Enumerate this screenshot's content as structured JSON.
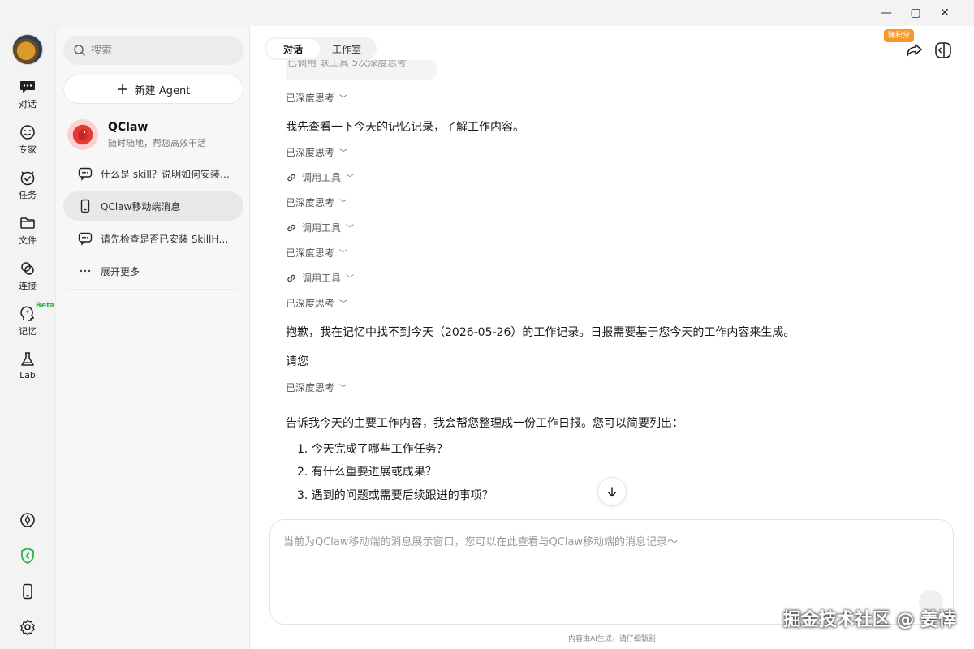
{
  "window": {
    "minimize": "—",
    "maximize": "▢",
    "close": "✕"
  },
  "rail": {
    "items": [
      {
        "label": "对话",
        "icon": "chat-icon"
      },
      {
        "label": "专家",
        "icon": "expert-icon"
      },
      {
        "label": "任务",
        "icon": "task-icon"
      },
      {
        "label": "文件",
        "icon": "folder-icon"
      },
      {
        "label": "连接",
        "icon": "connect-icon"
      },
      {
        "label": "记忆",
        "icon": "memory-icon",
        "badge": "Beta"
      },
      {
        "label": "Lab",
        "icon": "flask-icon"
      }
    ],
    "bottom_icons": [
      "compass-icon",
      "shield-icon",
      "phone-icon",
      "settings-icon"
    ]
  },
  "panel": {
    "search_placeholder": "搜索",
    "new_agent": "新建 Agent",
    "agent": {
      "name": "QClaw",
      "subtitle": "随时随地，帮您高效干活"
    },
    "conversations": [
      {
        "label": "什么是 skill？说明如何安装…",
        "icon": "chat-bubble-icon",
        "active": false
      },
      {
        "label": "QClaw移动端消息",
        "icon": "phone-icon",
        "active": true
      },
      {
        "label": "请先检查是否已安装 SkillH…",
        "icon": "chat-bubble-icon",
        "active": false
      },
      {
        "label": "展开更多",
        "icon": "more-icon",
        "active": false
      }
    ]
  },
  "main": {
    "tabs": [
      {
        "label": "对话",
        "active": true
      },
      {
        "label": "工作室",
        "active": false
      }
    ],
    "points_badge": "赚积分",
    "cut_bubble": "已调用 联工具 5次深度思考",
    "messages": [
      {
        "type": "think",
        "label": "已深度思考"
      },
      {
        "type": "text",
        "text": "我先查看一下今天的记忆记录，了解工作内容。"
      },
      {
        "type": "think",
        "label": "已深度思考"
      },
      {
        "type": "tool",
        "label": "调用工具"
      },
      {
        "type": "think",
        "label": "已深度思考"
      },
      {
        "type": "tool",
        "label": "调用工具"
      },
      {
        "type": "think",
        "label": "已深度思考"
      },
      {
        "type": "tool",
        "label": "调用工具"
      },
      {
        "type": "think",
        "label": "已深度思考"
      },
      {
        "type": "text",
        "text": "抱歉，我在记忆中找不到今天（2026-05-26）的工作记录。日报需要基于您今天的工作内容来生成。"
      },
      {
        "type": "text",
        "text": "请您"
      },
      {
        "type": "think",
        "label": "已深度思考"
      },
      {
        "type": "text",
        "text": "告诉我今天的主要工作内容，我会帮您整理成一份工作日报。您可以简要列出："
      }
    ],
    "list": [
      "1. 今天完成了哪些工作任务？",
      "2. 有什么重要进展或成果？",
      "3. 遇到的问题或需要后续跟进的事项？"
    ],
    "input_placeholder": "当前为QClaw移动端的消息展示窗口，您可以在此查看与QClaw移动端的消息记录～",
    "footer_note": "内容由AI生成，请仔细甄别"
  },
  "watermark": "掘金技术社区 @ 姜悻"
}
